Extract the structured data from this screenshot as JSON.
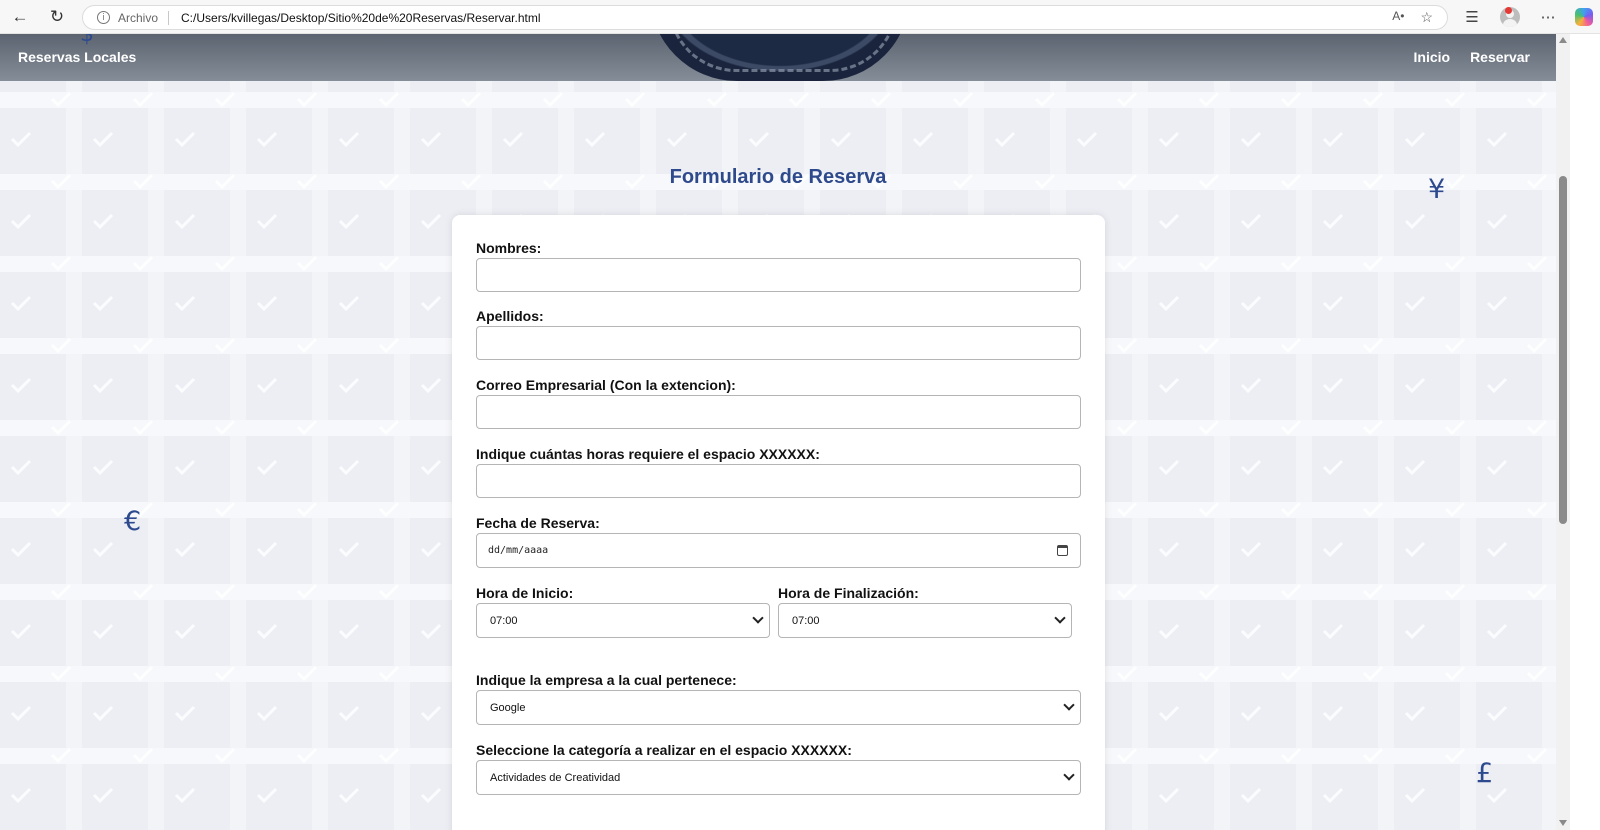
{
  "browser": {
    "scheme_label": "Archivo",
    "url": "C:/Users/kvillegas/Desktop/Sitio%20de%20Reservas/Reservar.html"
  },
  "header": {
    "brand": "Reservas Locales",
    "nav": [
      "Inicio",
      "Reservar"
    ]
  },
  "page": {
    "title": "Formulario de Reserva",
    "decorations": [
      "¥",
      "€",
      "£"
    ]
  },
  "form": {
    "nombres_label": "Nombres:",
    "nombres_value": "",
    "apellidos_label": "Apellidos:",
    "apellidos_value": "",
    "correo_label": "Correo Empresarial (Con la extencion):",
    "correo_value": "",
    "horas_label": "Indique cuántas horas requiere el espacio XXXXXX:",
    "horas_value": "",
    "fecha_label": "Fecha de Reserva:",
    "fecha_placeholder": "dd/mm/aaaa",
    "hora_inicio_label": "Hora de Inicio:",
    "hora_inicio_value": "07:00",
    "hora_fin_label": "Hora de Finalización:",
    "hora_fin_value": "07:00",
    "empresa_label": "Indique la empresa a la cual pertenece:",
    "empresa_value": "Google",
    "categoria_label": "Seleccione la categoría a realizar en el espacio XXXXXX:",
    "categoria_value": "Actividades de Creatividad"
  }
}
